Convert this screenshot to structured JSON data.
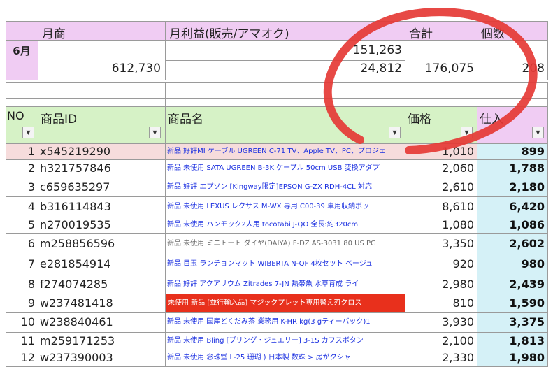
{
  "summary": {
    "month_label": "6月",
    "col_monthly_sales": "月商",
    "col_monthly_profit": "月利益(販売/アマオク)",
    "col_total": "合計",
    "col_count": "個数",
    "monthly_sales_value": "612,730",
    "profit_line1": "151,263",
    "profit_line2": "24,812",
    "total_value": "176,075",
    "count_value": "208"
  },
  "table": {
    "headers": {
      "no": "NO",
      "product_id": "商品ID",
      "product_name": "商品名",
      "price": "価格",
      "cost": "仕入"
    },
    "dropdown_glyph": "▼",
    "rows": [
      {
        "no": "1",
        "id": "x545219290",
        "name": "新品 好評MI ケーブル UGREEN C-71 TV、Apple TV、PC、プロジェ",
        "price": "1,010",
        "cost": "899",
        "style": "highlight"
      },
      {
        "no": "2",
        "id": "h321757846",
        "name": "新品 未使用 SATA UGREEN B-3K ケーブル 50cm USB 変換アダプ",
        "price": "2,060",
        "cost": "1,788",
        "style": "blue"
      },
      {
        "no": "3",
        "id": "c659635297",
        "name": "新品 好評 エプソン [Kingway限定]EPSON G-ZX RDH-4CL 対応",
        "price": "2,610",
        "cost": "2,180",
        "style": "blue"
      },
      {
        "no": "4",
        "id": "b316114843",
        "name": "新品 未使用 LEXUS レクサス M-WX 専用 C00-39 車用収納ボッ",
        "price": "8,610",
        "cost": "6,420",
        "style": "blue"
      },
      {
        "no": "5",
        "id": "n270019535",
        "name": "新品 未使用 ハンモック2人用 tocotabi J-QO 全長:約320cm",
        "price": "1,080",
        "cost": "1,086",
        "style": "blue"
      },
      {
        "no": "6",
        "id": "m258856596",
        "name": "新品 未使用 ミニトート ダイヤ(DAIYA) F-DZ AS-3031 80 US PG",
        "price": "3,350",
        "cost": "2,602",
        "style": "gray"
      },
      {
        "no": "7",
        "id": "e281854914",
        "name": "新品 目玉 ランチョンマット WIBERTA N-QF 4枚セット ベージュ",
        "price": "920",
        "cost": "980",
        "style": "blue"
      },
      {
        "no": "8",
        "id": "f274074285",
        "name": "新品 好評 アクアリウム Zitrades 7-JN 熱帯魚 水草育成 ライ",
        "price": "2,980",
        "cost": "2,439",
        "style": "blue"
      },
      {
        "no": "9",
        "id": "w237481418",
        "name": "未使用 新品 [並行輸入品] マジックプレット専用替え刃クロス",
        "price": "810",
        "cost": "1,590",
        "style": "red"
      },
      {
        "no": "10",
        "id": "w238840461",
        "name": "新品 未使用 国産どくだみ茶 業務用 K-HR kg(3 gティーバック)1",
        "price": "3,930",
        "cost": "3,375",
        "style": "blue"
      },
      {
        "no": "11",
        "id": "m259171253",
        "name": "新品 未使用 Bling [ブリング・ジュエリー] 3-1S カフスボタン",
        "price": "2,100",
        "cost": "1,813",
        "style": "blue"
      },
      {
        "no": "12",
        "id": "w237390003",
        "name": "新品 未使用 念珠堂 L-25 珊瑚 ) 日本製 数珠 > 房がクシャ",
        "price": "2,330",
        "cost": "1,980",
        "style": "blue"
      }
    ]
  },
  "colors": {
    "header_pink": "#f0ccf3",
    "header_green": "#d6f2c6",
    "row_highlight": "#f6dcdc",
    "cost_fill": "#d5f1f7",
    "red_row": "#e8301c",
    "annotation_red": "#e53935"
  }
}
